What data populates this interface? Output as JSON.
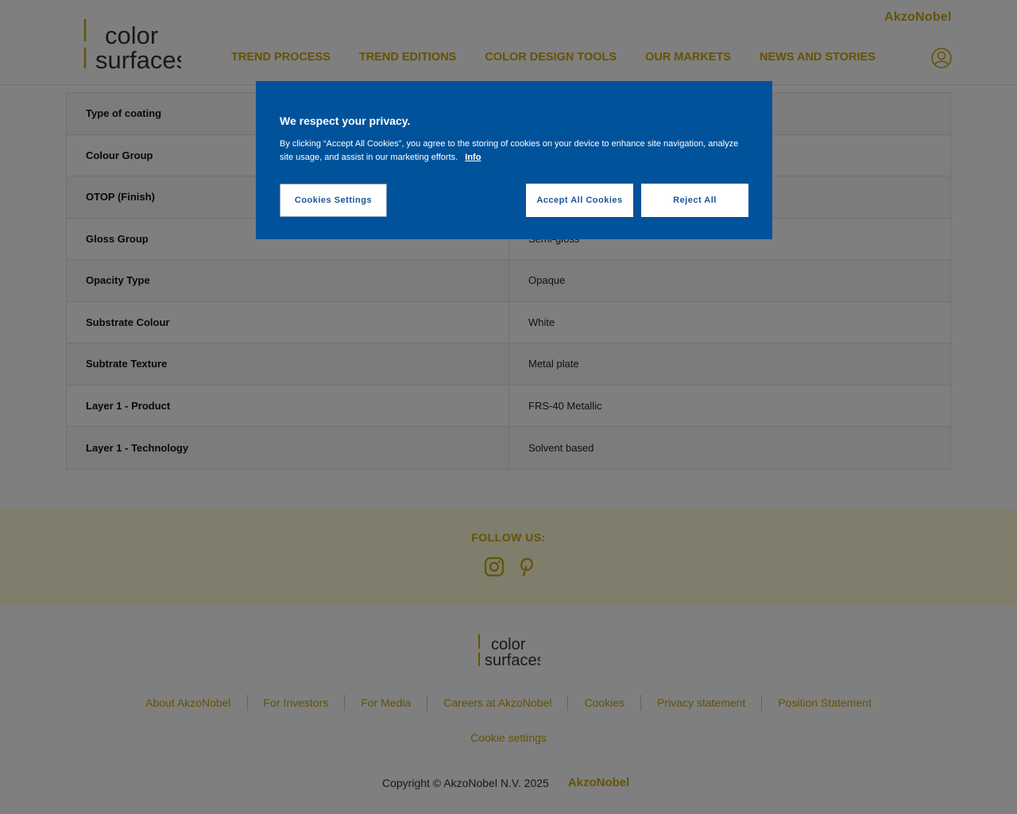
{
  "header": {
    "brand": "AkzoNobel",
    "logo_line1": "color",
    "logo_line2": "surfaces",
    "nav": [
      "TREND PROCESS",
      "TREND EDITIONS",
      "COLOR DESIGN TOOLS",
      "OUR MARKETS",
      "NEWS AND STORIES"
    ]
  },
  "table": {
    "rows": [
      {
        "label": "Type of coating",
        "value": ""
      },
      {
        "label": "Colour Group",
        "value": ""
      },
      {
        "label": "OTOP (Finish)",
        "value": ""
      },
      {
        "label": "Gloss Group",
        "value": "Semi-gloss"
      },
      {
        "label": "Opacity Type",
        "value": "Opaque"
      },
      {
        "label": "Substrate Colour",
        "value": "White"
      },
      {
        "label": "Subtrate Texture",
        "value": "Metal plate"
      },
      {
        "label": "Layer 1 - Product",
        "value": "FRS-40 Metallic"
      },
      {
        "label": "Layer 1 - Technology",
        "value": "Solvent based"
      }
    ]
  },
  "follow": {
    "title": "FOLLOW US:",
    "icons": [
      "instagram-icon",
      "pinterest-icon"
    ]
  },
  "footer": {
    "links": [
      "About AkzoNobel",
      "For Investors",
      "For Media",
      "Careers at AkzoNobel",
      "Cookies",
      "Privacy statement",
      "Position Statement"
    ],
    "cookie_settings": "Cookie settings",
    "copyright": "Copyright © AkzoNobel N.V. 2025",
    "brand": "AkzoNobel"
  },
  "cookie_dialog": {
    "title": "We respect your privacy.",
    "text": "By clicking “Accept All Cookies”, you agree to the storing of cookies on your device to enhance site navigation, analyze site usage, and assist in our marketing efforts.",
    "info_link": "Info",
    "settings_button": "Cookies Settings",
    "accept_button": "Accept All Cookies",
    "reject_button": "Reject All"
  },
  "colors": {
    "accent": "#c9a70a",
    "dialog_bg": "#00529b",
    "follow_bg": "#fffbd9"
  }
}
